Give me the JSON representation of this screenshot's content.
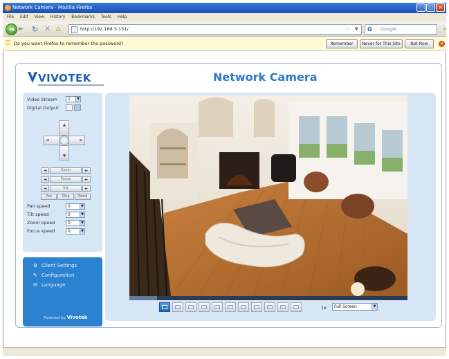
{
  "window": {
    "title": "Network Camera - Mozilla Firefox"
  },
  "menubar": [
    "File",
    "Edit",
    "View",
    "History",
    "Bookmarks",
    "Tools",
    "Help"
  ],
  "nav": {
    "url": "http://192.168.5.151/",
    "search_placeholder": "Google"
  },
  "password_bar": {
    "message": "Do you want Firefox to remember the password?",
    "remember": "Remember",
    "never": "Never for This Site",
    "not_now": "Not Now"
  },
  "header": {
    "logo": "VIVOTEK",
    "title": "Network Camera"
  },
  "controls": {
    "video_stream_label": "Video Stream",
    "video_stream_value": "1",
    "digital_output_label": "Digital Output",
    "zoom_rows": [
      {
        "minus": "◄",
        "label": "Zoom",
        "plus": "►"
      },
      {
        "minus": "◄",
        "label": "Focus",
        "plus": "►"
      },
      {
        "minus": "◄",
        "label": "Iris",
        "plus": "►"
      }
    ],
    "scan_buttons": [
      "Pan",
      "Stop",
      "Patrol"
    ],
    "speeds": [
      {
        "label": "Pan speed",
        "value": "0"
      },
      {
        "label": "Tilt speed",
        "value": "0"
      },
      {
        "label": "Zoom speed",
        "value": "0"
      },
      {
        "label": "Focus speed",
        "value": "0"
      }
    ]
  },
  "menu": {
    "items": [
      {
        "icon": "gear-icon",
        "label": "Client Settings"
      },
      {
        "icon": "wrench-icon",
        "label": "Configuration"
      },
      {
        "icon": "speech-bubble-icon",
        "label": "Language"
      }
    ],
    "powered_by": "Powered by",
    "powered_brand": "Vivotek"
  },
  "video_toolbar": {
    "zoom_label": "1x",
    "zoom_value": "Full Screen"
  }
}
